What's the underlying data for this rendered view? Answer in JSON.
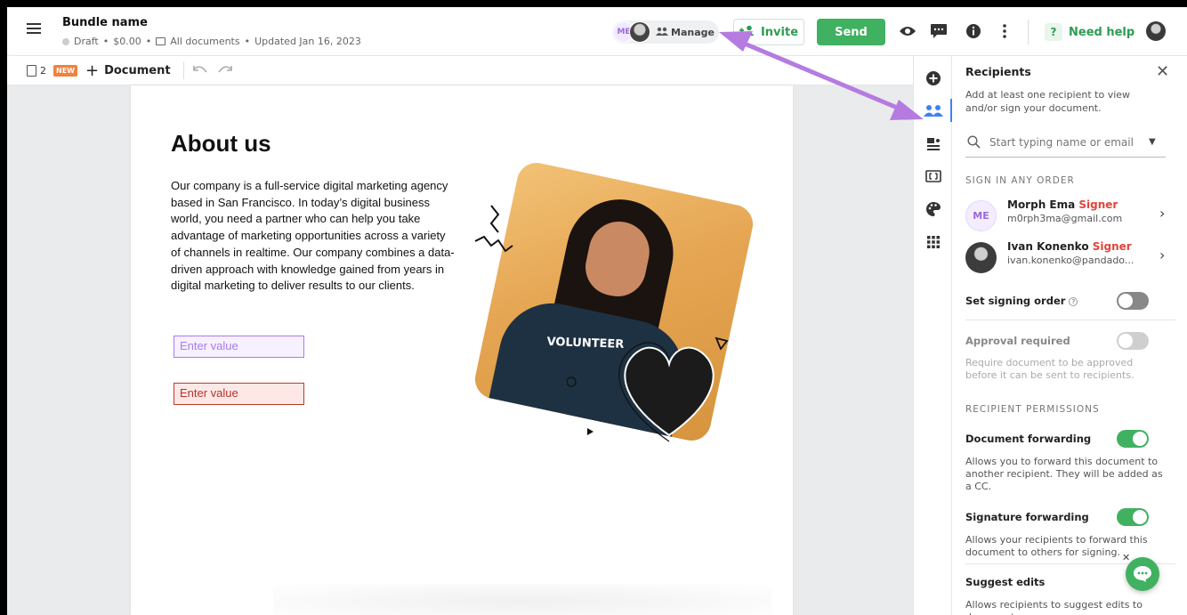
{
  "header": {
    "bundle_name": "Bundle name",
    "status": "Draft",
    "price": "$0.00",
    "folder": "All documents",
    "updated": "Updated Jan 16, 2023",
    "manage_initials": "ME",
    "manage_label": "Manage",
    "invite_label": "Invite",
    "send_label": "Send",
    "help_label": "Need help",
    "help_glyph": "?"
  },
  "toolbar": {
    "page_count": "2",
    "new_badge": "NEW",
    "add_document_label": "Document"
  },
  "document": {
    "title": "About us",
    "body": "Our company is a full-service digital marketing agency based in San Francisco. In today’s digital business world, you need a partner who can help you take advantage of marketing opportunities across a variety of channels in realtime. Our company combines a data-driven approach with knowledge gained from years in digital marketing to deliver results to our clients.",
    "field1_placeholder": "Enter value",
    "field2_placeholder": "Enter value",
    "shirt_text": "VOLUNTEER"
  },
  "panel": {
    "title": "Recipients",
    "description": "Add at least one recipient to view and/or sign your document.",
    "search_placeholder": "Start typing name or email",
    "order_section": "SIGN IN ANY ORDER",
    "recipients": [
      {
        "initials": "ME",
        "name": "Morph Ema",
        "role": "Signer",
        "email": "m0rph3ma@gmail.com"
      },
      {
        "initials": "",
        "name": "Ivan Konenko",
        "role": "Signer",
        "email": "ivan.konenko@pandado..."
      }
    ],
    "set_signing_order": "Set signing order",
    "approval_required": "Approval required",
    "approval_note": "Require document to be approved before it can be sent to recipients.",
    "permissions_section": "RECIPIENT PERMISSIONS",
    "doc_forwarding": "Document forwarding",
    "doc_forwarding_note": "Allows you to forward this document to another recipient. They will be added as a CC.",
    "sig_forwarding": "Signature forwarding",
    "sig_forwarding_note": "Allows your recipients to forward this document to others for signing.",
    "suggest_edits": "Suggest edits",
    "suggest_edits_note": "Allows recipients to suggest edits to document."
  },
  "colors": {
    "brand_green": "#3fb160",
    "signer_red": "#e0443b",
    "annotation_arrow": "#b57be0",
    "active_blue": "#3b82f6"
  },
  "icons": [
    "menu-icon",
    "folder-icon",
    "people-icon",
    "invite-icon",
    "eye-icon",
    "chat-icon",
    "info-icon",
    "more-icon",
    "undo-icon",
    "redo-icon",
    "plus-circle-icon",
    "recipients-icon",
    "fields-icon",
    "embed-icon",
    "palette-icon",
    "apps-icon",
    "search-icon",
    "chevron-right-icon",
    "close-icon"
  ]
}
